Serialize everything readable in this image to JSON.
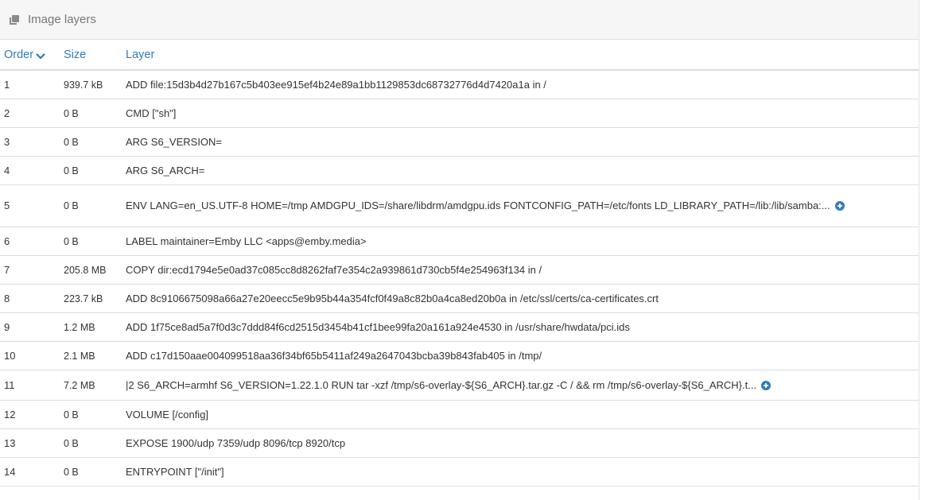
{
  "panel": {
    "title": "Image layers",
    "title_icon": "layers-icon"
  },
  "columns": {
    "order": "Order",
    "size": "Size",
    "layer": "Layer",
    "sort_icon": "chevron-down-icon"
  },
  "colors": {
    "accent": "#337ab7",
    "expand_icon": "#337ab7",
    "header_bg": "#f6f6f6"
  },
  "rows": [
    {
      "order": "1",
      "size": "939.7 kB",
      "layer": "ADD file:15d3b4d27b167c5b403ee915ef4b24e89a1bb1129853dc68732776d4d7420a1a in /",
      "expandable": false
    },
    {
      "order": "2",
      "size": "0 B",
      "layer": "CMD [\"sh\"]",
      "expandable": false
    },
    {
      "order": "3",
      "size": "0 B",
      "layer": "ARG S6_VERSION=",
      "expandable": false
    },
    {
      "order": "4",
      "size": "0 B",
      "layer": "ARG S6_ARCH=",
      "expandable": false
    },
    {
      "order": "5",
      "size": "0 B",
      "layer": "ENV LANG=en_US.UTF-8 HOME=/tmp AMDGPU_IDS=/share/libdrm/amdgpu.ids FONTCONFIG_PATH=/etc/fonts LD_LIBRARY_PATH=/lib:/lib/samba:...",
      "expandable": true
    },
    {
      "order": "6",
      "size": "0 B",
      "layer": "LABEL maintainer=Emby LLC <apps@emby.media>",
      "expandable": false
    },
    {
      "order": "7",
      "size": "205.8 MB",
      "layer": "COPY dir:ecd1794e5e0ad37c085cc8d8262faf7e354c2a939861d730cb5f4e254963f134 in /",
      "expandable": false
    },
    {
      "order": "8",
      "size": "223.7 kB",
      "layer": "ADD 8c9106675098a66a27e20eecc5e9b95b44a354fcf0f49a8c82b0a4ca8ed20b0a in /etc/ssl/certs/ca-certificates.crt",
      "expandable": false
    },
    {
      "order": "9",
      "size": "1.2 MB",
      "layer": "ADD 1f75ce8ad5a7f0d3c7ddd84f6cd2515d3454b41cf1bee99fa20a161a924e4530 in /usr/share/hwdata/pci.ids",
      "expandable": false
    },
    {
      "order": "10",
      "size": "2.1 MB",
      "layer": "ADD c17d150aae004099518aa36f34bf65b5411af249a2647043bcba39b843fab405 in /tmp/",
      "expandable": false
    },
    {
      "order": "11",
      "size": "7.2 MB",
      "layer": "|2 S6_ARCH=armhf S6_VERSION=1.22.1.0 RUN tar -xzf /tmp/s6-overlay-${S6_ARCH}.tar.gz -C / && rm /tmp/s6-overlay-${S6_ARCH}.t...",
      "expandable": true
    },
    {
      "order": "12",
      "size": "0 B",
      "layer": "VOLUME [/config]",
      "expandable": false
    },
    {
      "order": "13",
      "size": "0 B",
      "layer": "EXPOSE 1900/udp 7359/udp 8096/tcp 8920/tcp",
      "expandable": false
    },
    {
      "order": "14",
      "size": "0 B",
      "layer": "ENTRYPOINT [\"/init\"]",
      "expandable": false
    }
  ]
}
